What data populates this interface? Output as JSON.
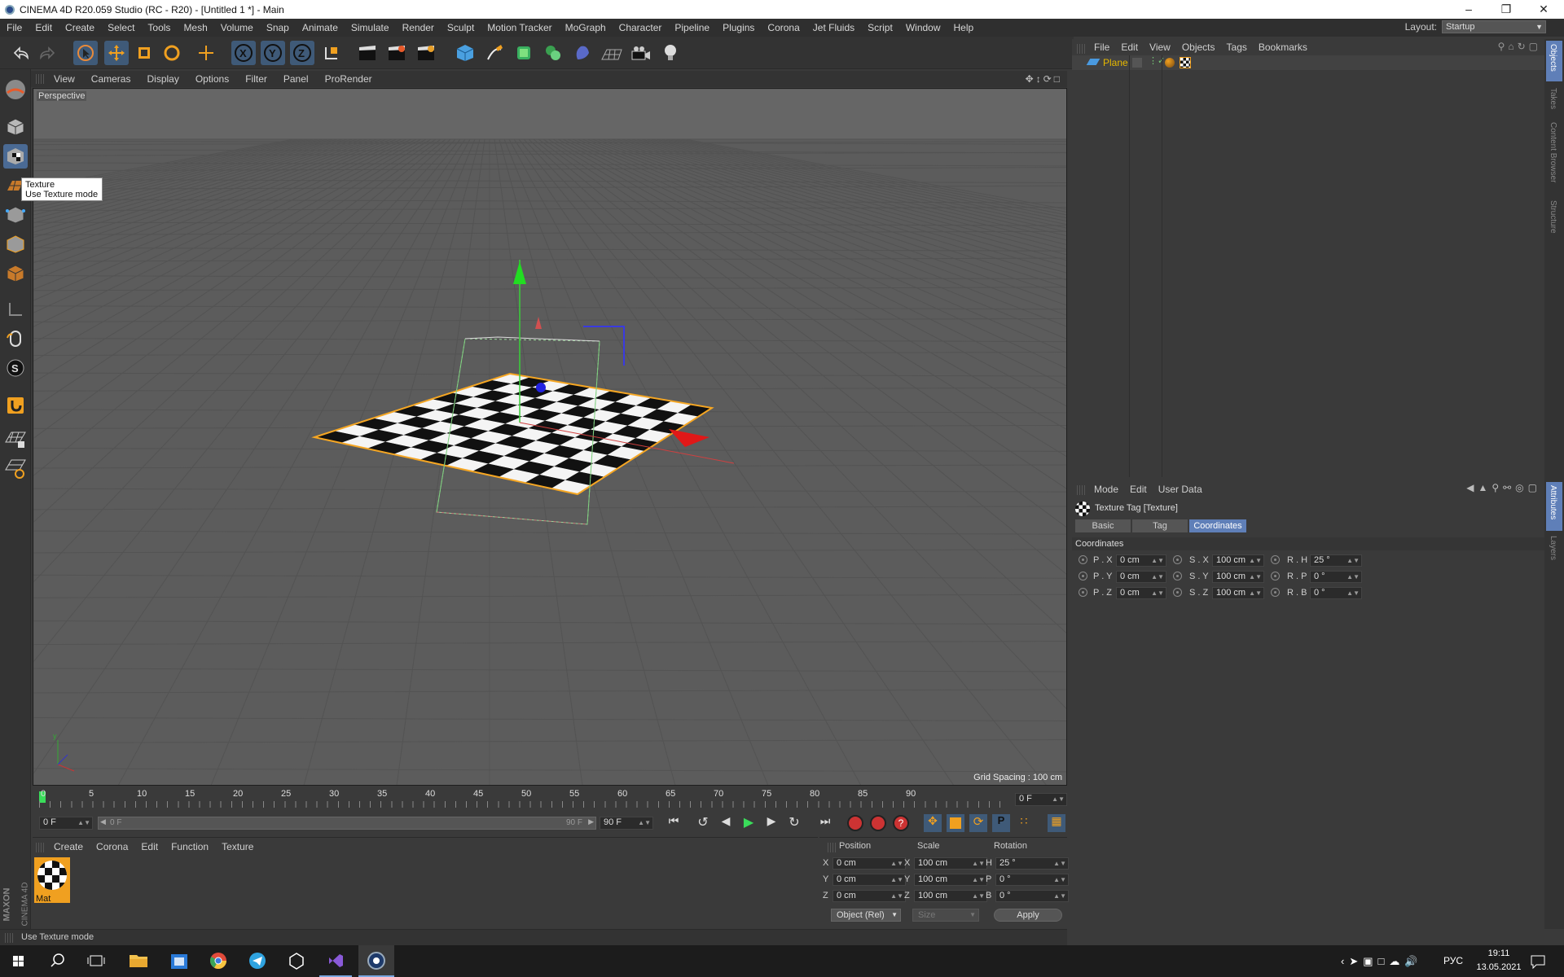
{
  "titlebar": {
    "title": "CINEMA 4D R20.059 Studio (RC - R20) - [Untitled 1 *] - Main"
  },
  "menubar": {
    "items": [
      "File",
      "Edit",
      "Create",
      "Select",
      "Tools",
      "Mesh",
      "Volume",
      "Snap",
      "Animate",
      "Simulate",
      "Render",
      "Sculpt",
      "Motion Tracker",
      "MoGraph",
      "Character",
      "Pipeline",
      "Plugins",
      "Corona",
      "Jet Fluids",
      "Script",
      "Window",
      "Help"
    ],
    "layout_label": "Layout:",
    "layout_value": "Startup"
  },
  "viewport": {
    "menu": [
      "View",
      "Cameras",
      "Display",
      "Options",
      "Filter",
      "Panel",
      "ProRender"
    ],
    "camera_label": "Perspective",
    "grid_spacing": "Grid Spacing : 100 cm",
    "tooltip_title": "Texture",
    "tooltip_desc": "Use Texture mode"
  },
  "timeline": {
    "ticks": [
      "0",
      "5",
      "10",
      "15",
      "20",
      "25",
      "30",
      "35",
      "40",
      "45",
      "50",
      "55",
      "60",
      "65",
      "70",
      "75",
      "80",
      "85",
      "90"
    ],
    "current_frame": "0 F"
  },
  "anim": {
    "start": "0 F",
    "range_start": "0 F",
    "range_end": "90 F",
    "end": "90 F"
  },
  "material_manager": {
    "menu": [
      "Create",
      "Corona",
      "Edit",
      "Function",
      "Texture"
    ],
    "materials": [
      {
        "name": "Mat"
      }
    ]
  },
  "coordinates": {
    "headers": [
      "Position",
      "Scale",
      "Rotation"
    ],
    "rows": [
      {
        "axis": "X",
        "pos": "0 cm",
        "sax": "X",
        "scale": "100 cm",
        "rax": "H",
        "rot": "25 °"
      },
      {
        "axis": "Y",
        "pos": "0 cm",
        "sax": "Y",
        "scale": "100 cm",
        "rax": "P",
        "rot": "0 °"
      },
      {
        "axis": "Z",
        "pos": "0 cm",
        "sax": "Z",
        "scale": "100 cm",
        "rax": "B",
        "rot": "0 °"
      }
    ],
    "mode": "Object (Rel)",
    "size_mode": "Size",
    "apply": "Apply"
  },
  "object_manager": {
    "menu": [
      "File",
      "Edit",
      "View",
      "Objects",
      "Tags",
      "Bookmarks"
    ],
    "objects": [
      {
        "name": "Plane"
      }
    ]
  },
  "attribute_manager": {
    "menu": [
      "Mode",
      "Edit",
      "User Data"
    ],
    "title": "Texture Tag [Texture]",
    "tabs": [
      "Basic",
      "Tag",
      "Coordinates"
    ],
    "active_tab": "Coordinates",
    "section": "Coordinates",
    "fields": [
      [
        {
          "label": "P . X",
          "value": "0 cm"
        },
        {
          "label": "S . X",
          "value": "100 cm"
        },
        {
          "label": "R . H",
          "value": "25 °"
        }
      ],
      [
        {
          "label": "P . Y",
          "value": "0 cm"
        },
        {
          "label": "S . Y",
          "value": "100 cm"
        },
        {
          "label": "R . P",
          "value": "0 °"
        }
      ],
      [
        {
          "label": "P . Z",
          "value": "0 cm"
        },
        {
          "label": "S . Z",
          "value": "100 cm"
        },
        {
          "label": "R . B",
          "value": "0 °"
        }
      ]
    ]
  },
  "right_tabs": [
    "Objects",
    "Takes",
    "Content Browser",
    "Structure",
    "Attributes",
    "Layers"
  ],
  "statusbar": {
    "text": "Use Texture mode"
  },
  "brand": {
    "line1": "MAXON",
    "line2": "CINEMA 4D"
  },
  "taskbar": {
    "lang": "РУС",
    "time": "19:11",
    "date": "13.05.2021"
  },
  "colors": {
    "accent": "#5a7cb0",
    "active_tab": "#5f7fb8",
    "selection": "#f5a623",
    "plane_label": "#e6b800"
  }
}
